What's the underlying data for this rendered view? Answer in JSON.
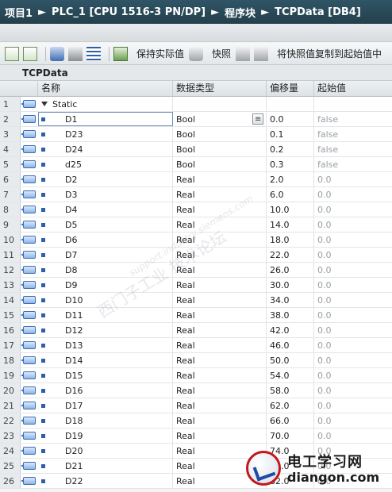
{
  "breadcrumb": [
    "项目1",
    "PLC_1 [CPU 1516-3 PN/DP]",
    "程序块",
    "TCPData [DB4]"
  ],
  "toolbar": {
    "keep_actual": "保持实际值",
    "snapshot": "快照",
    "copy_snapshot": "将快照值复制到起始值中"
  },
  "block_name": "TCPData",
  "headers": {
    "name": "名称",
    "type": "数据类型",
    "offset": "偏移量",
    "start": "起始值"
  },
  "static_row": {
    "num": "1",
    "name": "Static"
  },
  "rows": [
    {
      "num": "2",
      "name": "D1",
      "type": "Bool",
      "offset": "0.0",
      "start": "false"
    },
    {
      "num": "3",
      "name": "D23",
      "type": "Bool",
      "offset": "0.1",
      "start": "false"
    },
    {
      "num": "4",
      "name": "D24",
      "type": "Bool",
      "offset": "0.2",
      "start": "false"
    },
    {
      "num": "5",
      "name": "d25",
      "type": "Bool",
      "offset": "0.3",
      "start": "false"
    },
    {
      "num": "6",
      "name": "D2",
      "type": "Real",
      "offset": "2.0",
      "start": "0.0"
    },
    {
      "num": "7",
      "name": "D3",
      "type": "Real",
      "offset": "6.0",
      "start": "0.0"
    },
    {
      "num": "8",
      "name": "D4",
      "type": "Real",
      "offset": "10.0",
      "start": "0.0"
    },
    {
      "num": "9",
      "name": "D5",
      "type": "Real",
      "offset": "14.0",
      "start": "0.0"
    },
    {
      "num": "10",
      "name": "D6",
      "type": "Real",
      "offset": "18.0",
      "start": "0.0"
    },
    {
      "num": "11",
      "name": "D7",
      "type": "Real",
      "offset": "22.0",
      "start": "0.0"
    },
    {
      "num": "12",
      "name": "D8",
      "type": "Real",
      "offset": "26.0",
      "start": "0.0"
    },
    {
      "num": "13",
      "name": "D9",
      "type": "Real",
      "offset": "30.0",
      "start": "0.0"
    },
    {
      "num": "14",
      "name": "D10",
      "type": "Real",
      "offset": "34.0",
      "start": "0.0"
    },
    {
      "num": "15",
      "name": "D11",
      "type": "Real",
      "offset": "38.0",
      "start": "0.0"
    },
    {
      "num": "16",
      "name": "D12",
      "type": "Real",
      "offset": "42.0",
      "start": "0.0"
    },
    {
      "num": "17",
      "name": "D13",
      "type": "Real",
      "offset": "46.0",
      "start": "0.0"
    },
    {
      "num": "18",
      "name": "D14",
      "type": "Real",
      "offset": "50.0",
      "start": "0.0"
    },
    {
      "num": "19",
      "name": "D15",
      "type": "Real",
      "offset": "54.0",
      "start": "0.0"
    },
    {
      "num": "20",
      "name": "D16",
      "type": "Real",
      "offset": "58.0",
      "start": "0.0"
    },
    {
      "num": "21",
      "name": "D17",
      "type": "Real",
      "offset": "62.0",
      "start": "0.0"
    },
    {
      "num": "22",
      "name": "D18",
      "type": "Real",
      "offset": "66.0",
      "start": "0.0"
    },
    {
      "num": "23",
      "name": "D19",
      "type": "Real",
      "offset": "70.0",
      "start": "0.0"
    },
    {
      "num": "24",
      "name": "D20",
      "type": "Real",
      "offset": "74.0",
      "start": "0.0"
    },
    {
      "num": "25",
      "name": "D21",
      "type": "Real",
      "offset": "78.0",
      "start": "0.0"
    },
    {
      "num": "26",
      "name": "D22",
      "type": "Real",
      "offset": "82.0",
      "start": "0.0"
    }
  ],
  "watermark": {
    "cn": "西门子工业 技术论坛",
    "en": "support.industry.siemens.com"
  },
  "logo": {
    "cn": "电工学习网",
    "en": "diangon.com"
  },
  "colors": {
    "titlebar": "#2f5566",
    "logo_red": "#c4161c",
    "logo_blue": "#1f4aa8"
  }
}
